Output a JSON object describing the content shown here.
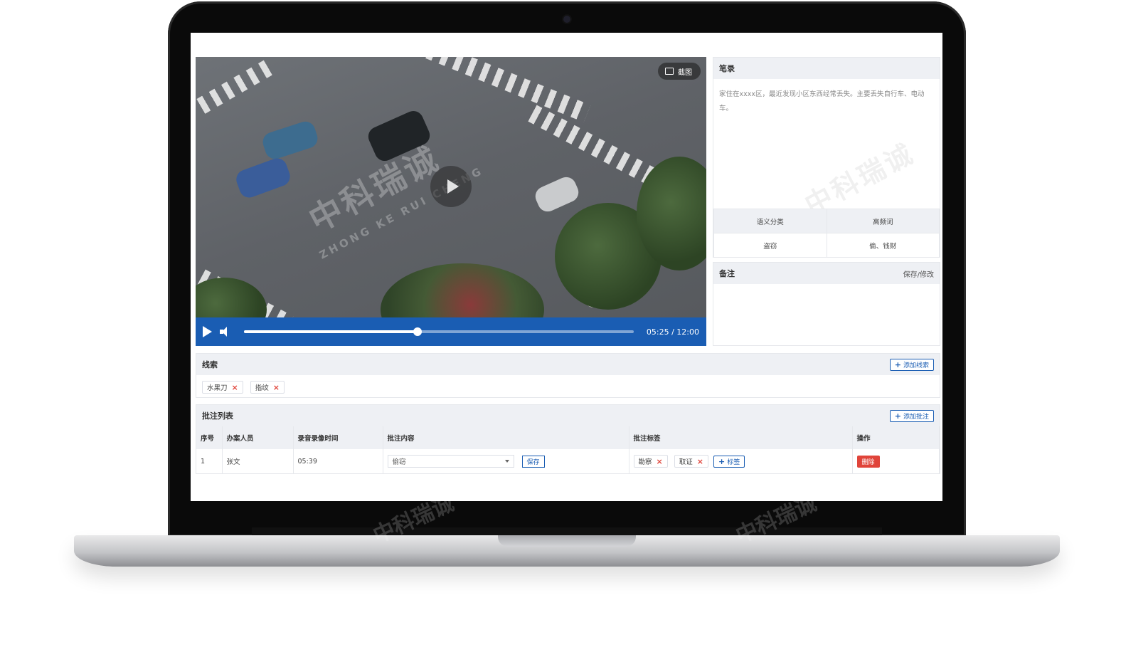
{
  "video": {
    "snapshot_label": "截图",
    "time": "05:25 / 12:00",
    "progress": 0.446,
    "watermark_cn": "中科瑞诚",
    "watermark_en": "ZHONG KE RUI CHENG"
  },
  "notes_panel": {
    "title": "笔录",
    "text": "家住在xxxx区，最近发现小区东西经常丢失。主要丢失自行车、电动车。",
    "semantic": {
      "col1_header": "语义分类",
      "col2_header": "高频词",
      "col1_value": "盗窃",
      "col2_value": "偷、钱财"
    }
  },
  "remarks_panel": {
    "title": "备注",
    "action": "保存/修改"
  },
  "clues": {
    "title": "线索",
    "add_button": "添加线索",
    "tags": [
      "水果刀",
      "指纹"
    ]
  },
  "annotations": {
    "title": "批注列表",
    "add_button": "添加批注",
    "columns": [
      "序号",
      "办案人员",
      "录音录像时间",
      "批注内容",
      "批注标签",
      "操作"
    ],
    "rows": [
      {
        "index": "1",
        "officer": "张文",
        "time": "05:39",
        "content": "偷窃",
        "save_label": "保存",
        "tags": [
          "勘察",
          "取证"
        ],
        "add_tag_label": "标签",
        "delete_label": "删除"
      }
    ]
  },
  "colors": {
    "accent": "#1a5db3",
    "danger": "#e0443a"
  }
}
